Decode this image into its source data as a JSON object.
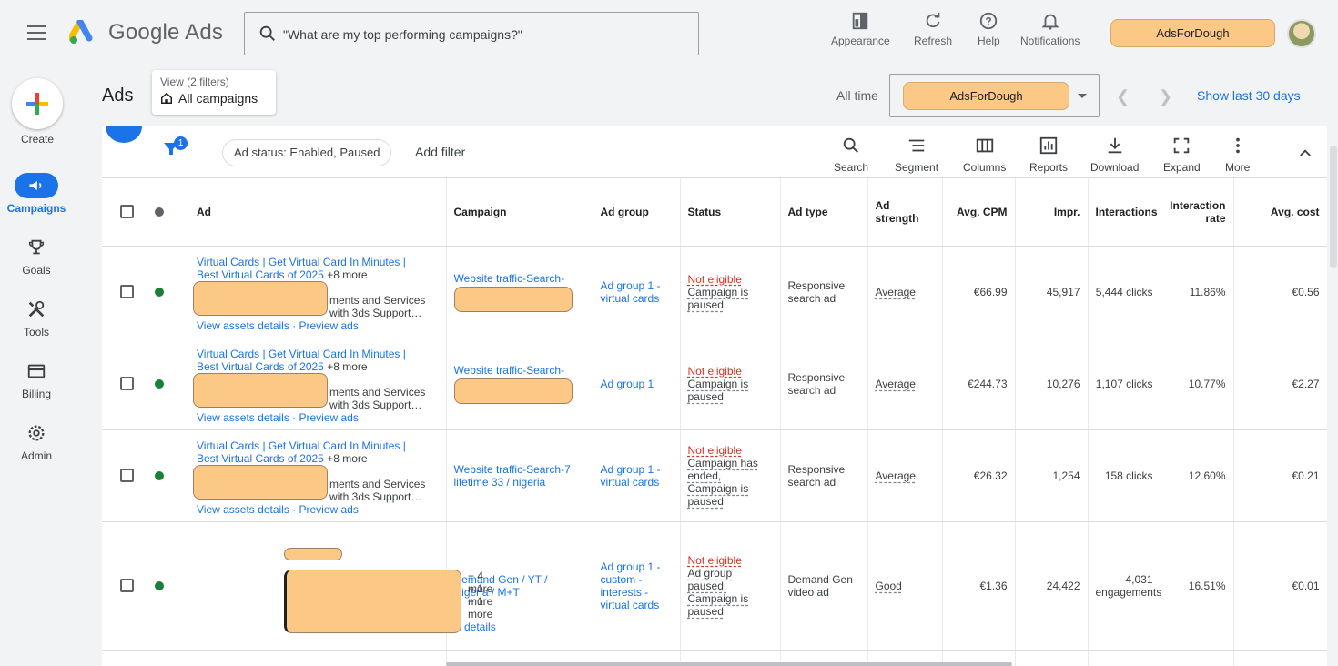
{
  "app": {
    "name": "Google Ads",
    "search_placeholder": "\"What are my top performing campaigns?\""
  },
  "top_tools": [
    {
      "label": "Appearance",
      "icon": "appearance-icon"
    },
    {
      "label": "Refresh",
      "icon": "refresh-icon"
    },
    {
      "label": "Help",
      "icon": "help-icon"
    },
    {
      "label": "Notifications",
      "icon": "bell-icon"
    }
  ],
  "account": {
    "name": "AdsForDough"
  },
  "sidebar": {
    "create_label": "Create",
    "items": [
      {
        "label": "Campaigns",
        "icon": "campaigns-icon",
        "active": true
      },
      {
        "label": "Goals",
        "icon": "trophy-icon"
      },
      {
        "label": "Tools",
        "icon": "tools-icon"
      },
      {
        "label": "Billing",
        "icon": "billing-icon"
      },
      {
        "label": "Admin",
        "icon": "gear-icon"
      }
    ]
  },
  "header": {
    "title": "Ads",
    "view_sub": "View (2 filters)",
    "view_main": "All campaigns",
    "time_label": "All time",
    "show_last": "Show last 30 days"
  },
  "filterbar": {
    "badge": "1",
    "chip": "Ad status: Enabled, Paused",
    "add_filter": "Add filter",
    "tools": [
      {
        "label": "Search",
        "icon": "search-icon"
      },
      {
        "label": "Segment",
        "icon": "segment-icon"
      },
      {
        "label": "Columns",
        "icon": "columns-icon"
      },
      {
        "label": "Reports",
        "icon": "reports-icon"
      },
      {
        "label": "Download",
        "icon": "download-icon"
      },
      {
        "label": "Expand",
        "icon": "expand-icon"
      },
      {
        "label": "More",
        "icon": "more-vert-icon"
      }
    ]
  },
  "table": {
    "headers": [
      "Ad",
      "Campaign",
      "Ad group",
      "Status",
      "Ad type",
      "Ad strength",
      "Avg. CPM",
      "Impr.",
      "Interactions",
      "Interaction rate",
      "Avg. cost"
    ],
    "rows": [
      {
        "ad_headline": "Virtual Cards | Get Virtual Card In Minutes | Best Virtual Cards of 2025",
        "ad_more": "+8 more",
        "ad_desc1": "ments and Services",
        "ad_desc2": "with 3ds Support…",
        "ad_links": "View assets details · Preview ads",
        "campaign": "Website traffic-Search-",
        "campaign_redacted": true,
        "ad_group": "Ad group 1 - virtual cards",
        "status_title": "Not eligible",
        "status_detail": "Campaign is paused",
        "ad_type": "Responsive search ad",
        "ad_strength": "Average",
        "cpm": "€66.99",
        "impr": "45,917",
        "interactions": "5,444 clicks",
        "rate": "11.86%",
        "cost": "€0.56"
      },
      {
        "ad_headline": "Virtual Cards | Get Virtual Card In Minutes | Best Virtual Cards of 2025",
        "ad_more": "+8 more",
        "ad_desc1": "ments and Services",
        "ad_desc2": "with 3ds Support…",
        "ad_links": "View assets details · Preview ads",
        "campaign": "Website traffic-Search-",
        "campaign_redacted": true,
        "ad_group": "Ad group 1",
        "status_title": "Not eligible",
        "status_detail": "Campaign is paused",
        "ad_type": "Responsive search ad",
        "ad_strength": "Average",
        "cpm": "€244.73",
        "impr": "10,276",
        "interactions": "1,107 clicks",
        "rate": "10.77%",
        "cost": "€2.27"
      },
      {
        "ad_headline": "Virtual Cards | Get Virtual Card In Minutes | Best Virtual Cards of 2025",
        "ad_more": "+8 more",
        "ad_desc1": "ments and Services",
        "ad_desc2": "with 3ds Support…",
        "ad_links": "View assets details · Preview ads",
        "campaign": "Website traffic-Search-7 lifetime 33 / nigeria",
        "campaign_redacted": false,
        "ad_group": "Ad group 1 - virtual cards",
        "status_title": "Not eligible",
        "status_detail": "Campaign has ended, Campaign is paused",
        "ad_type": "Responsive search ad",
        "ad_strength": "Average",
        "cpm": "€26.32",
        "impr": "1,254",
        "interactions": "158 clicks",
        "rate": "12.60%",
        "cost": "€0.21"
      },
      {
        "ad_more1": "+ 4 more",
        "ad_more2": "+ 1 more",
        "ad_more3": "+ 1 more",
        "ad_links": "details",
        "campaign": "Demand Gen / YT / Nigeria / M+T",
        "ad_group": "Ad group 1 - custom - interests - virtual cards",
        "status_title": "Not eligible",
        "status_detail": "Ad group paused, Campaign is paused",
        "ad_type": "Demand Gen video ad",
        "ad_strength": "Good",
        "cpm": "€1.36",
        "impr": "24,422",
        "interactions": "4,031 engagements",
        "rate": "16.51%",
        "cost": "€0.01"
      }
    ]
  },
  "colors": {
    "accent": "#1a73e8",
    "redaction": "#fcc886",
    "status_green": "#188038",
    "error_red": "#d93025"
  }
}
